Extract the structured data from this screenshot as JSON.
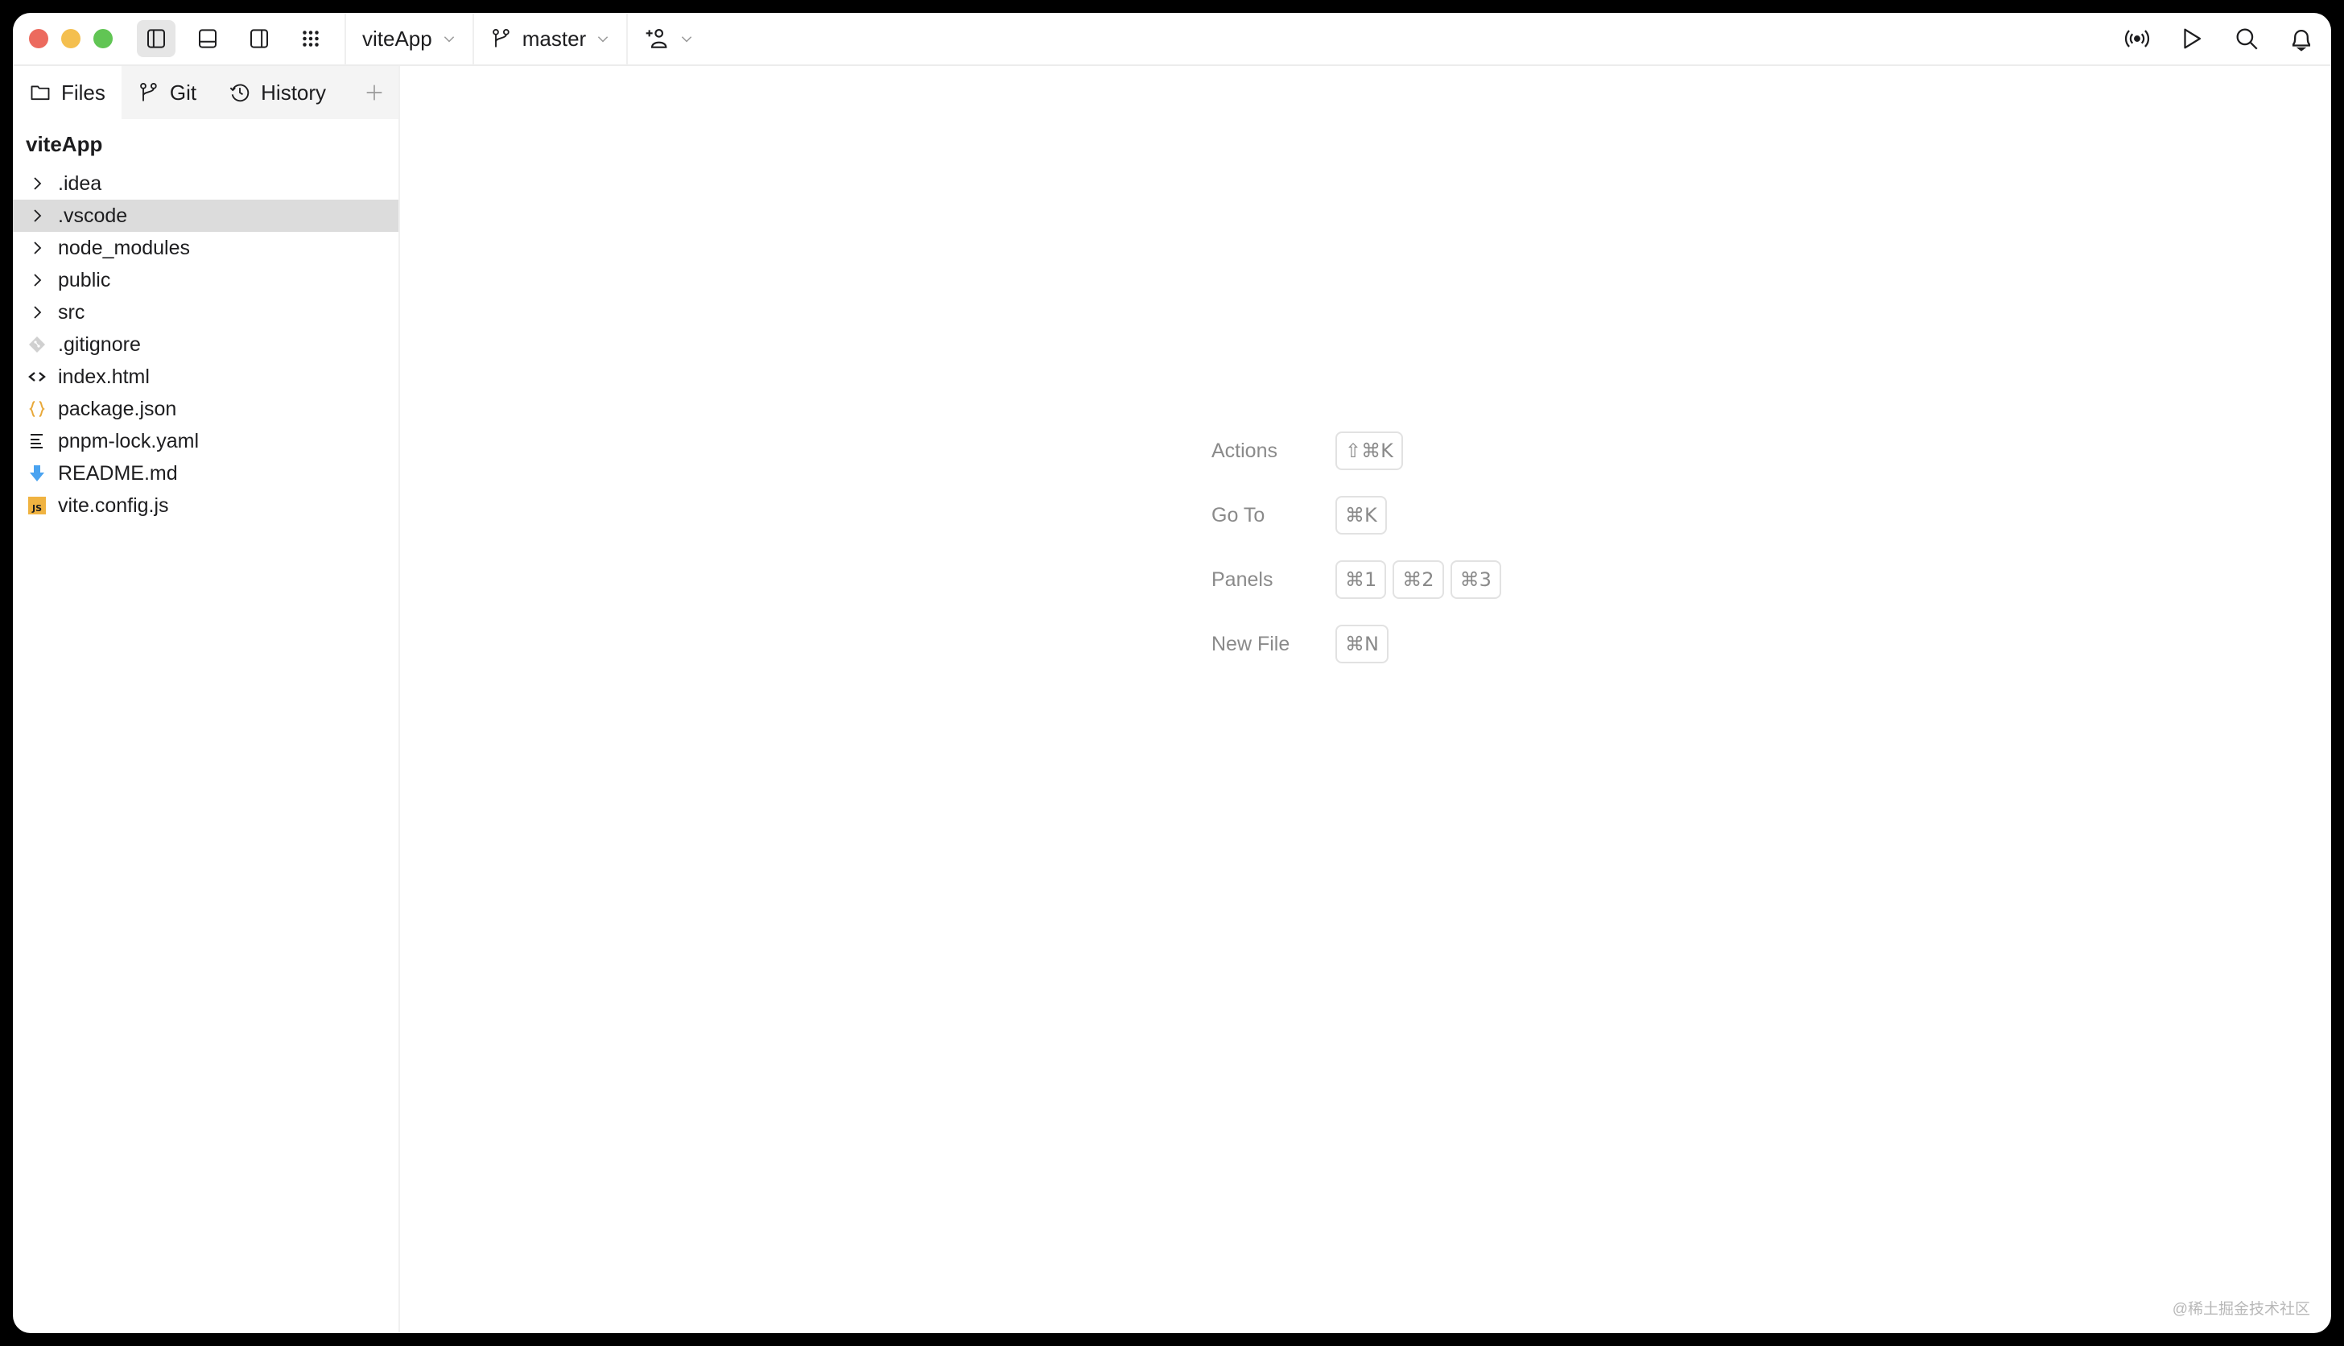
{
  "titlebar": {
    "traffic_lights": [
      "close",
      "minimize",
      "maximize"
    ],
    "layout_buttons": [
      {
        "icon": "sidebar-left-icon",
        "active": true
      },
      {
        "icon": "panel-bottom-icon",
        "active": false
      },
      {
        "icon": "sidebar-right-icon",
        "active": false
      },
      {
        "icon": "grid-dots-icon",
        "active": false
      }
    ],
    "project_label": "viteApp",
    "branch_label": "master",
    "right_icons": [
      "broadcast-icon",
      "play-icon",
      "search-icon",
      "bell-icon"
    ]
  },
  "sidebar": {
    "tabs": [
      {
        "label": "Files",
        "icon": "folder-icon",
        "active": true
      },
      {
        "label": "Git",
        "icon": "git-branch-icon",
        "active": false
      },
      {
        "label": "History",
        "icon": "history-icon",
        "active": false
      }
    ],
    "project_title": "viteApp",
    "tree": [
      {
        "name": ".idea",
        "type": "folder",
        "selected": false
      },
      {
        "name": ".vscode",
        "type": "folder",
        "selected": true
      },
      {
        "name": "node_modules",
        "type": "folder",
        "selected": false
      },
      {
        "name": "public",
        "type": "folder",
        "selected": false
      },
      {
        "name": "src",
        "type": "folder",
        "selected": false
      },
      {
        "name": ".gitignore",
        "type": "git",
        "selected": false
      },
      {
        "name": "index.html",
        "type": "html",
        "selected": false
      },
      {
        "name": "package.json",
        "type": "json",
        "selected": false
      },
      {
        "name": "pnpm-lock.yaml",
        "type": "yaml",
        "selected": false
      },
      {
        "name": "README.md",
        "type": "markdown",
        "selected": false
      },
      {
        "name": "vite.config.js",
        "type": "js",
        "selected": false
      }
    ],
    "js_badge_text": "JS"
  },
  "main": {
    "shortcuts": [
      {
        "label": "Actions",
        "keys": [
          "⇧⌘K"
        ]
      },
      {
        "label": "Go To",
        "keys": [
          "⌘K"
        ]
      },
      {
        "label": "Panels",
        "keys": [
          "⌘1",
          "⌘2",
          "⌘3"
        ]
      },
      {
        "label": "New File",
        "keys": [
          "⌘N"
        ]
      }
    ],
    "watermark": "@稀土掘金技术社区"
  },
  "colors": {
    "close": "#ec6a5e",
    "minimize": "#f4bf4f",
    "maximize": "#61c554",
    "selected_row": "#dcdcdc",
    "json_icon": "#e8a93b",
    "markdown_icon": "#4aa3f0",
    "js_badge": "#f0b341"
  }
}
